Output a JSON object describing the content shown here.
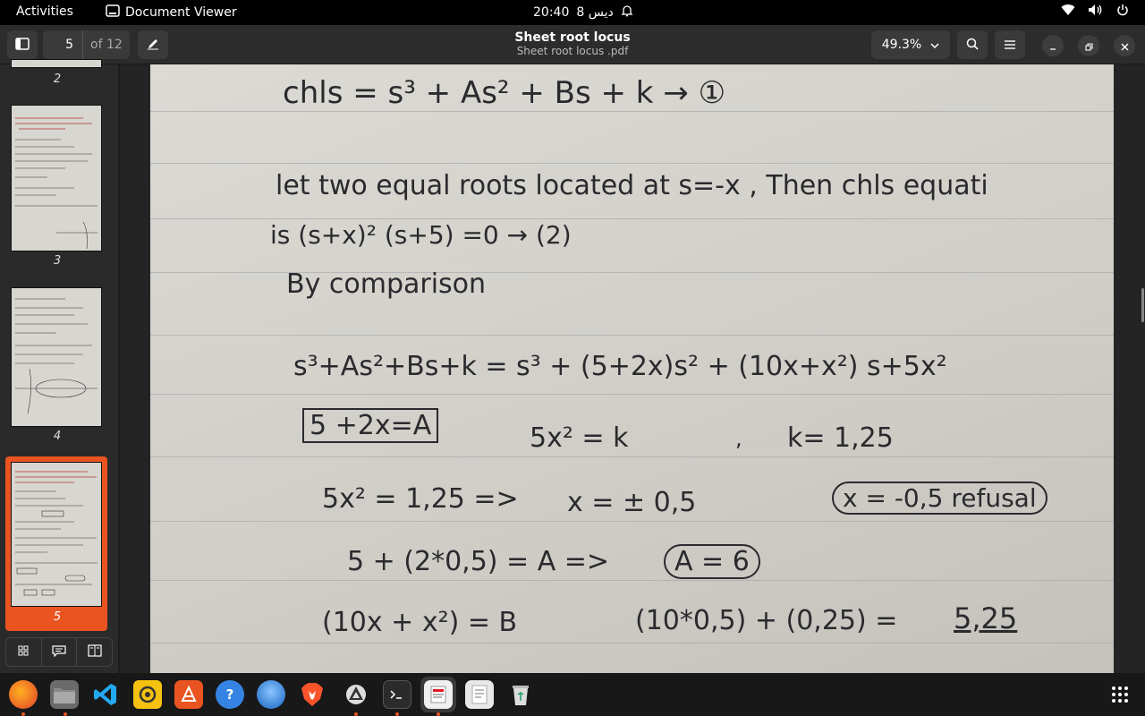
{
  "topbar": {
    "activities": "Activities",
    "app_name": "Document Viewer",
    "clock": "20:40",
    "date": "8 ديس"
  },
  "toolbar": {
    "page_current": "5",
    "page_total": "of 12",
    "title": "Sheet root locus",
    "subtitle": "Sheet root locus .pdf",
    "zoom": "49.3%"
  },
  "sidebar": {
    "pages": [
      {
        "label": "2"
      },
      {
        "label": "3"
      },
      {
        "label": "4"
      },
      {
        "label": "5",
        "selected": true
      }
    ]
  },
  "document": {
    "lines": [
      "chls  =  s³ + As² + Bs + k  → ①",
      "let two equal roots located at s=-x , Then chls equati",
      "is     (s+x)² (s+5) =0 → (2)",
      "By comparison",
      "s³+As²+Bs+k = s³ + (5+2x)s² + (10x+x²) s+5x²",
      "5 +2x=A",
      "5x² = k",
      ",",
      "k= 1,25",
      "5x² = 1,25  =>",
      "x = ± 0,5",
      "x = -0,5  refusal",
      "5 + (2*0,5) = A   =>",
      "A = 6",
      "(10x + x²) = B",
      "(10*0,5) + (0,25)  =",
      "5,25"
    ]
  },
  "dock": {
    "apps": [
      "firefox",
      "files",
      "vscode",
      "rhythmbox",
      "software",
      "help",
      "thunderbird",
      "brave",
      "inkscape",
      "terminal",
      "document-viewer",
      "text-editor",
      "trash"
    ]
  }
}
